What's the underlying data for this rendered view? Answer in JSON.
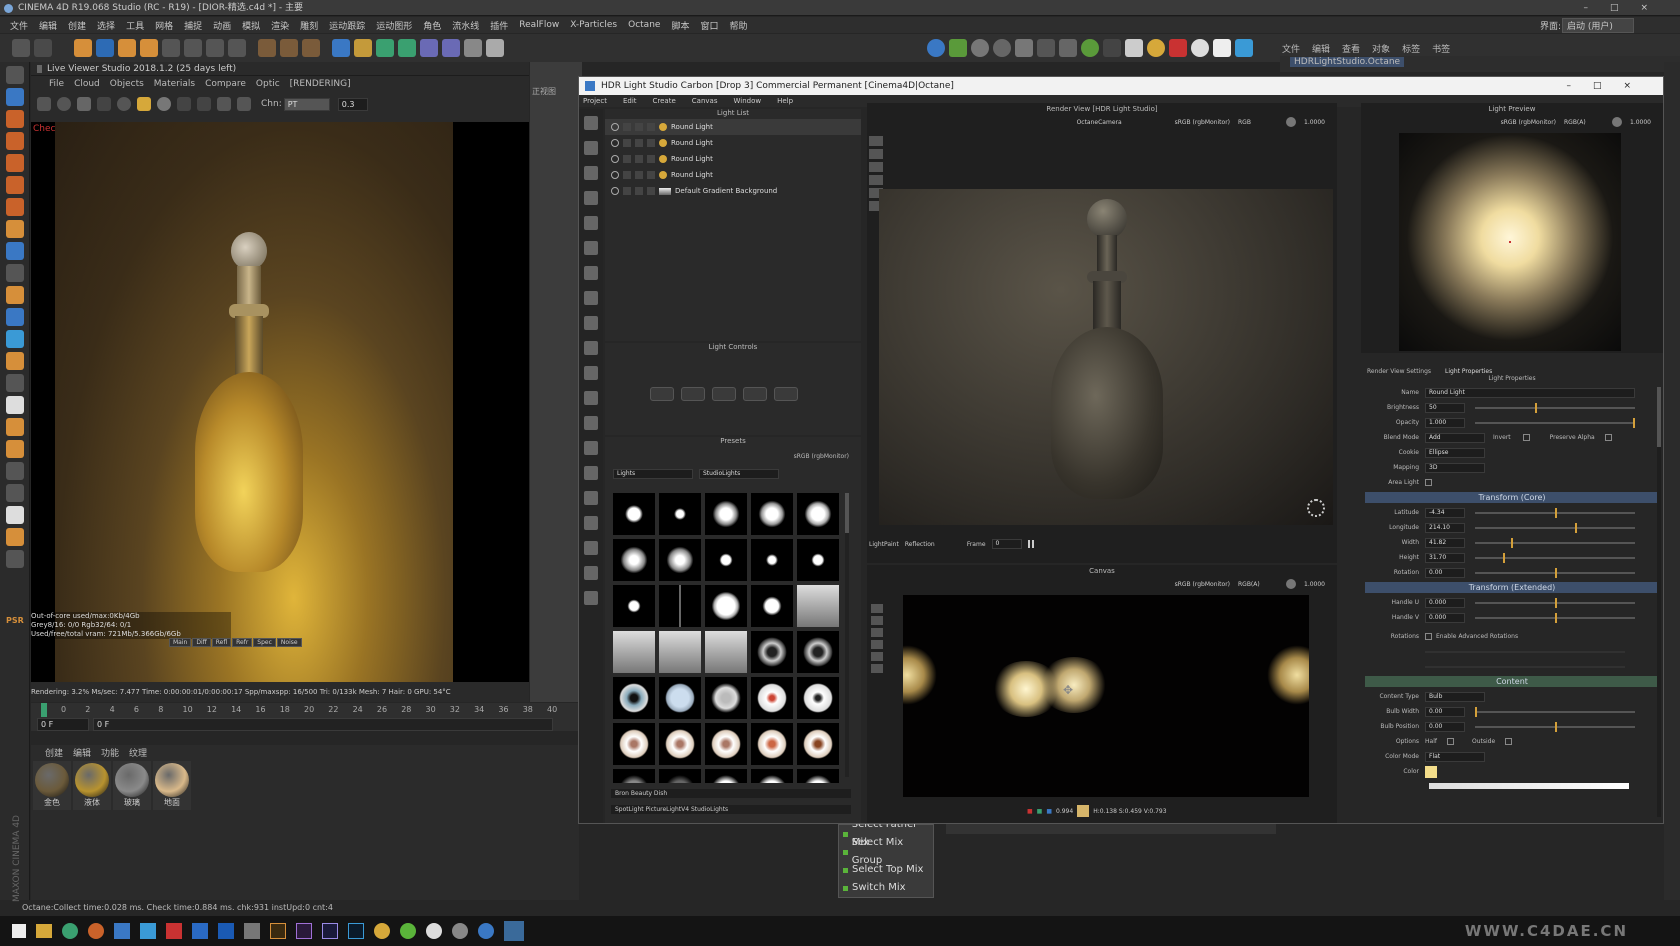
{
  "c4d": {
    "title": "CINEMA 4D R19.068 Studio (RC - R19) - [DIOR-精选.c4d *] - 主要",
    "menus": [
      "文件",
      "编辑",
      "创建",
      "选择",
      "工具",
      "网格",
      "捕捉",
      "动画",
      "模拟",
      "渲染",
      "雕刻",
      "运动跟踪",
      "运动图形",
      "角色",
      "流水线",
      "插件",
      "RealFlow",
      "X-Particles",
      "Octane",
      "脚本",
      "窗口",
      "帮助"
    ],
    "layout_label": "界面:",
    "layout_value": "启动 (用户)",
    "right_menus": [
      "文件",
      "编辑",
      "查看",
      "对象",
      "标签",
      "书签"
    ],
    "object_name": "HDRLightStudio.Octane",
    "status": "Octane:Collect time:0.028 ms.  Check time:0.884 ms.  chk:931  instUpd:0  cnt:4",
    "watermark": "WWW.C4DAE.CN",
    "brand": "MAXON CINEMA 4D"
  },
  "live_viewer": {
    "title": "Live Viewer Studio 2018.1.2 (25 days left)",
    "menus": [
      "File",
      "Cloud",
      "Objects",
      "Materials",
      "Compare",
      "Optic"
    ],
    "state": "[RENDERING]",
    "chn_label": "Chn:",
    "chn_value": "PT",
    "value": "0.3",
    "check": "Check",
    "stats": [
      "Out-of-core used/max:0Kb/4Gb",
      "Grey8/16: 0/0        Rgb32/64: 0/1",
      "Used/free/total vram: 721Mb/5.366Gb/6Gb"
    ],
    "stat_tabs": [
      "Main",
      "Diff",
      "Refl",
      "Refr",
      "Spec",
      "Noise"
    ],
    "render_line": "Rendering: 3.2%    Ms/sec: 7.477    Time: 0:00:00:01/0:00:00:17    Spp/maxspp: 16/500    Tri: 0/133k    Mesh: 7    Hair: 0    GPU: 54°C"
  },
  "timeline": {
    "ticks": [
      "0",
      "2",
      "4",
      "6",
      "8",
      "10",
      "12",
      "14",
      "16",
      "18",
      "20",
      "22",
      "24",
      "26",
      "28",
      "30",
      "32",
      "34",
      "36",
      "38",
      "40"
    ],
    "frame_field": "0 F",
    "frame_field2": "0 F"
  },
  "materials": {
    "tabs": [
      "创建",
      "编辑",
      "功能",
      "纹理"
    ],
    "items": [
      {
        "name": "金色",
        "swatch": "#6b5a3a"
      },
      {
        "name": "液体",
        "swatch": "#b8932f"
      },
      {
        "name": "玻璃",
        "swatch": "#8a8a8a"
      },
      {
        "name": "地面",
        "swatch": "#d9b98a"
      }
    ]
  },
  "hdr": {
    "title": "HDR Light Studio Carbon [Drop 3] Commercial Permanent [Cinema4D|Octane]",
    "menus": [
      "Project",
      "Edit",
      "Create",
      "Canvas",
      "Window",
      "Help"
    ],
    "light_list": {
      "title": "Light List",
      "items": [
        "Round Light",
        "Round Light",
        "Round Light",
        "Round Light",
        "Default Gradient Background"
      ]
    },
    "light_controls_title": "Light Controls",
    "presets": {
      "title": "Presets",
      "colorspace": "sRGB (rgbMonitor)",
      "category": "Lights",
      "subcategory": "StudioLights",
      "footer1": "Bron Beauty Dish",
      "footer2": "SpotLight PictureLightV4 StudioLights"
    },
    "render_view": {
      "title": "Render View [HDR Light Studio]",
      "camera": "OctaneCamera",
      "colorspace": "sRGB (rgbMonitor)",
      "mode": "RGB",
      "exposure": "1.0000",
      "lightpaint_label": "LightPaint",
      "lightpaint_value": "Reflection",
      "frame_label": "Frame",
      "frame_value": "0"
    },
    "canvas": {
      "title": "Canvas",
      "colorspace": "sRGB (rgbMonitor)",
      "mode": "RGB(A)",
      "exposure": "1.0000",
      "pixel_value": "0.994",
      "readout": "H:0.138  S:0.459  V:0.793"
    },
    "light_preview": {
      "title": "Light Preview",
      "colorspace": "sRGB (rgbMonitor)",
      "mode": "RGB(A)",
      "exposure": "1.0000"
    },
    "properties": {
      "tabs": [
        "Render View Settings",
        "Light Properties"
      ],
      "title": "Light Properties",
      "name_label": "Name",
      "name_value": "Round Light",
      "brightness_label": "Brightness",
      "brightness_value": "50",
      "opacity_label": "Opacity",
      "opacity_value": "1.000",
      "blend_label": "Blend Mode",
      "blend_value": "Add",
      "invert_label": "Invert",
      "preserve_alpha_label": "Preserve Alpha",
      "cookie_label": "Cookie",
      "cookie_value": "Ellipse",
      "mapping_label": "Mapping",
      "mapping_value": "3D",
      "area_light_label": "Area Light",
      "transform_core": "Transform (Core)",
      "latitude_label": "Latitude",
      "latitude_value": "-4.34",
      "longitude_label": "Longitude",
      "longitude_value": "214.10",
      "width_label": "Width",
      "width_value": "41.82",
      "height_label": "Height",
      "height_value": "31.70",
      "rotation_label": "Rotation",
      "rotation_value": "0.00",
      "transform_ext": "Transform (Extended)",
      "handle_u_label": "Handle U",
      "handle_u_value": "0.000",
      "handle_v_label": "Handle V",
      "handle_v_value": "0.000",
      "rotations_label": "Rotations",
      "adv_rot_label": "Enable Advanced Rotations",
      "content": "Content",
      "content_type_label": "Content Type",
      "content_type_value": "Bulb",
      "bulb_width_label": "Bulb Width",
      "bulb_width_value": "0.00",
      "bulb_position_label": "Bulb Position",
      "bulb_position_value": "0.00",
      "options_label": "Options",
      "half_label": "Half",
      "outside_label": "Outside",
      "color_mode_label": "Color Mode",
      "color_mode_value": "Flat",
      "color_label": "Color",
      "color_hex": "#f3dd8a"
    }
  },
  "context_menu": [
    "Select Father Mix",
    "Select Mix Group",
    "Select Top Mix",
    "Switch Mix"
  ],
  "colors": {
    "accent": "#d4a03a",
    "selection": "#3d4f6b",
    "c4d_bg": "#262626"
  }
}
